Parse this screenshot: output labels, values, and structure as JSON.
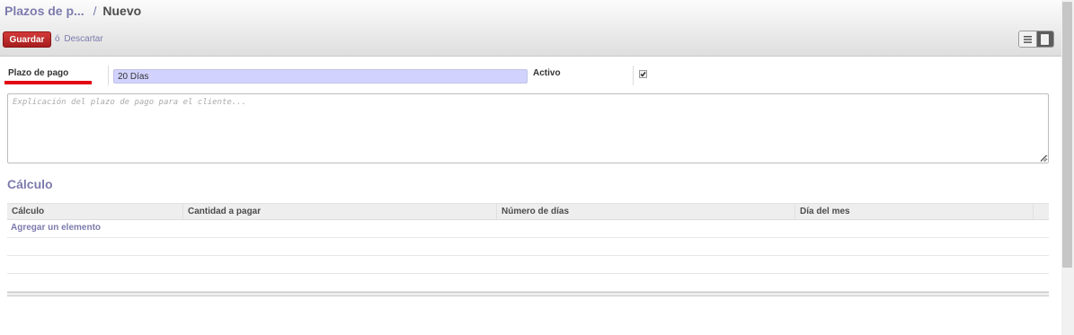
{
  "breadcrumb": {
    "parent": "Plazos de p...",
    "separator": "/",
    "current": "Nuevo"
  },
  "toolbar": {
    "save_label": "Guardar",
    "or_label": "ó",
    "discard_label": "Descartar"
  },
  "form": {
    "name_label": "Plazo de pago",
    "name_value": "20 Días",
    "active_label": "Activo",
    "active_checked": true,
    "note_placeholder": "Explicación del plazo de pago para el cliente..."
  },
  "section": {
    "title": "Cálculo"
  },
  "lines_table": {
    "columns": [
      "Cálculo",
      "Cantidad a pagar",
      "Número de días",
      "Día del mes"
    ],
    "add_item_label": "Agregar un elemento"
  },
  "colors": {
    "accent": "#7c7bad",
    "save_button": "#c02828",
    "input_bg": "#d2d2ff",
    "underline": "#e30613"
  },
  "icons": {
    "list_view": "list-view-icon",
    "form_view": "form-view-icon",
    "checkbox": "checkmark-icon"
  }
}
